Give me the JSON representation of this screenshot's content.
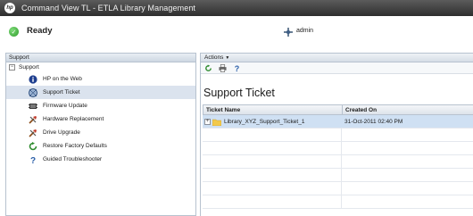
{
  "window": {
    "title": "Command View TL - ETLA Library Management"
  },
  "status": {
    "state": "Ready",
    "user": "admin"
  },
  "left_panel": {
    "header": "Support",
    "root": {
      "label": "Support",
      "toggle": "−"
    },
    "items": [
      {
        "label": "HP on the Web",
        "icon": "info-icon"
      },
      {
        "label": "Support Ticket",
        "icon": "support-ticket-icon",
        "selected": true
      },
      {
        "label": "Firmware Update",
        "icon": "firmware-icon"
      },
      {
        "label": "Hardware Replacement",
        "icon": "hardware-tools-icon"
      },
      {
        "label": "Drive Upgrade",
        "icon": "drive-tools-icon"
      },
      {
        "label": "Restore Factory Defaults",
        "icon": "restore-icon"
      },
      {
        "label": "Guided Troubleshooter",
        "icon": "question-icon"
      }
    ]
  },
  "right_panel": {
    "actions_label": "Actions",
    "toolbar": [
      "refresh-icon",
      "print-icon",
      "help-icon"
    ],
    "title": "Support Ticket",
    "columns": [
      "Ticket Name",
      "Created On"
    ],
    "rows": [
      {
        "expand": "+",
        "name": "Library_XYZ_Support_Ticket_1",
        "created": "31-Oct-2011 02:40 PM"
      }
    ]
  }
}
